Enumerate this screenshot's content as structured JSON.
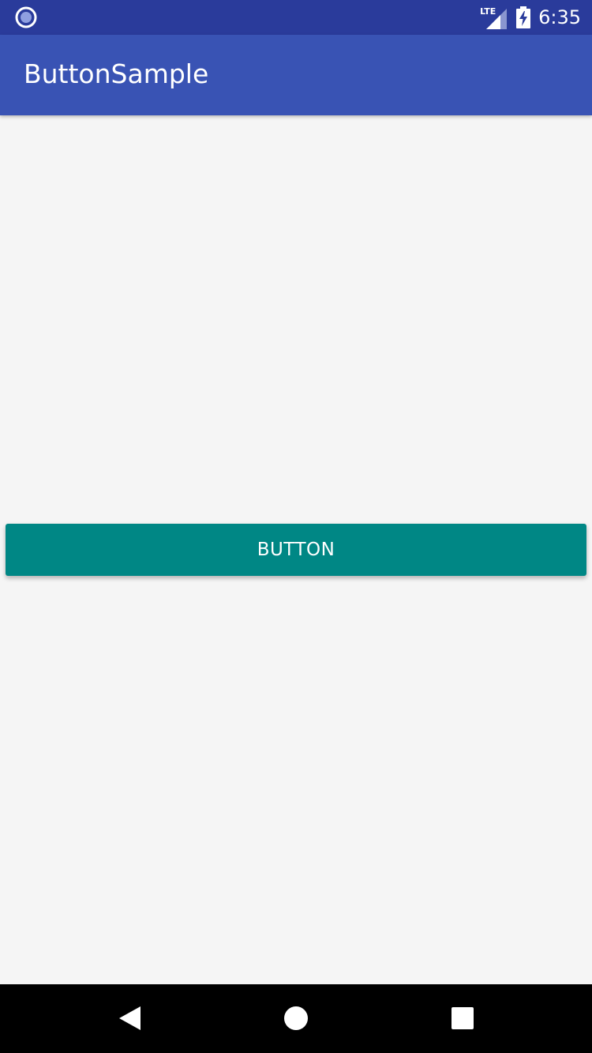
{
  "status_bar": {
    "left_icon": "notification-circle-icon",
    "network_label": "LTE",
    "signal_icon": "cell-signal-icon",
    "battery_icon": "battery-charging-icon",
    "time": "6:35",
    "background_color": "#2a3b9b"
  },
  "app_bar": {
    "title": "ButtonSample",
    "background_color": "#3953b4"
  },
  "content": {
    "button_label": "BUTTON",
    "button_color": "#008785",
    "background_color": "#f5f5f5"
  },
  "nav_bar": {
    "back_icon": "back-triangle-icon",
    "home_icon": "home-circle-icon",
    "recents_icon": "recents-square-icon"
  }
}
